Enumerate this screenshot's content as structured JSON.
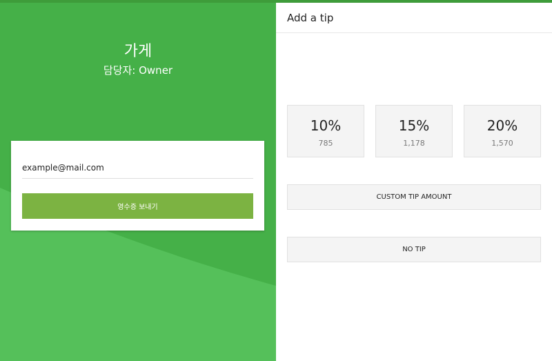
{
  "store": {
    "name": "가게",
    "staff": "담당자: Owner"
  },
  "receipt": {
    "email_value": "example@mail.com",
    "send_label": "영수증 보내기"
  },
  "tip_panel": {
    "title": "Add a tip",
    "options": [
      {
        "percent": "10%",
        "amount": "785"
      },
      {
        "percent": "15%",
        "amount": "1,178"
      },
      {
        "percent": "20%",
        "amount": "1,570"
      }
    ],
    "custom_label": "CUSTOM TIP AMOUNT",
    "no_tip_label": "NO TIP"
  },
  "colors": {
    "top_bar": "#3e9c3a",
    "left_panel": "#45b048",
    "wave_light": "#55c05a",
    "send_button": "#7cb342",
    "tip_option_bg": "#f4f4f4"
  }
}
